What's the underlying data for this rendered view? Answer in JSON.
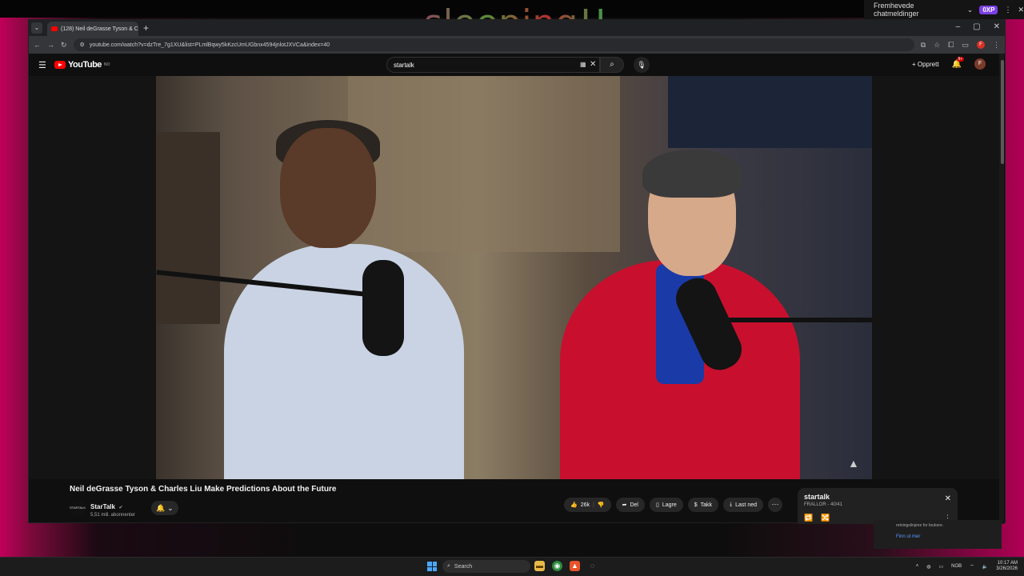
{
  "overlay": {
    "text": "sleeping!!"
  },
  "top_panel": {
    "label": "Fremhevede chatmeldinger",
    "badge": "0XP"
  },
  "browser": {
    "tab_title": "(128) Neil deGrasse Tyson & C",
    "url": "youtube.com/watch?v=dzTre_7g1XU&list=PLmlBqwy5kKzcUmUGbnx4594jnlotJXVCa&index=40"
  },
  "youtube": {
    "logo_text": "YouTube",
    "logo_region": "NO",
    "search_value": "startalk",
    "create_label": "Opprett",
    "notification_count": "9+",
    "avatar_letter": "F",
    "video_title": "Neil deGrasse Tyson & Charles Liu Make Predictions About the Future",
    "channel_name": "StarTalk",
    "channel_subs": "5,51 mill. abonnenter",
    "channel_avatar_text": "STARTALK",
    "actions": {
      "likes": "26k",
      "share": "Del",
      "save": "Lagre",
      "thanks": "Takk",
      "download": "Last ned"
    },
    "playlist": {
      "title": "startalk",
      "subtitle": "FRALLOR - 40/41"
    }
  },
  "toast": {
    "text": "retningslinjene for brukere.",
    "link": "Finn ut mer"
  },
  "taskbar": {
    "search_placeholder": "Search",
    "lang": "NOB",
    "time": "10:17 AM",
    "date": "3/26/2026"
  }
}
